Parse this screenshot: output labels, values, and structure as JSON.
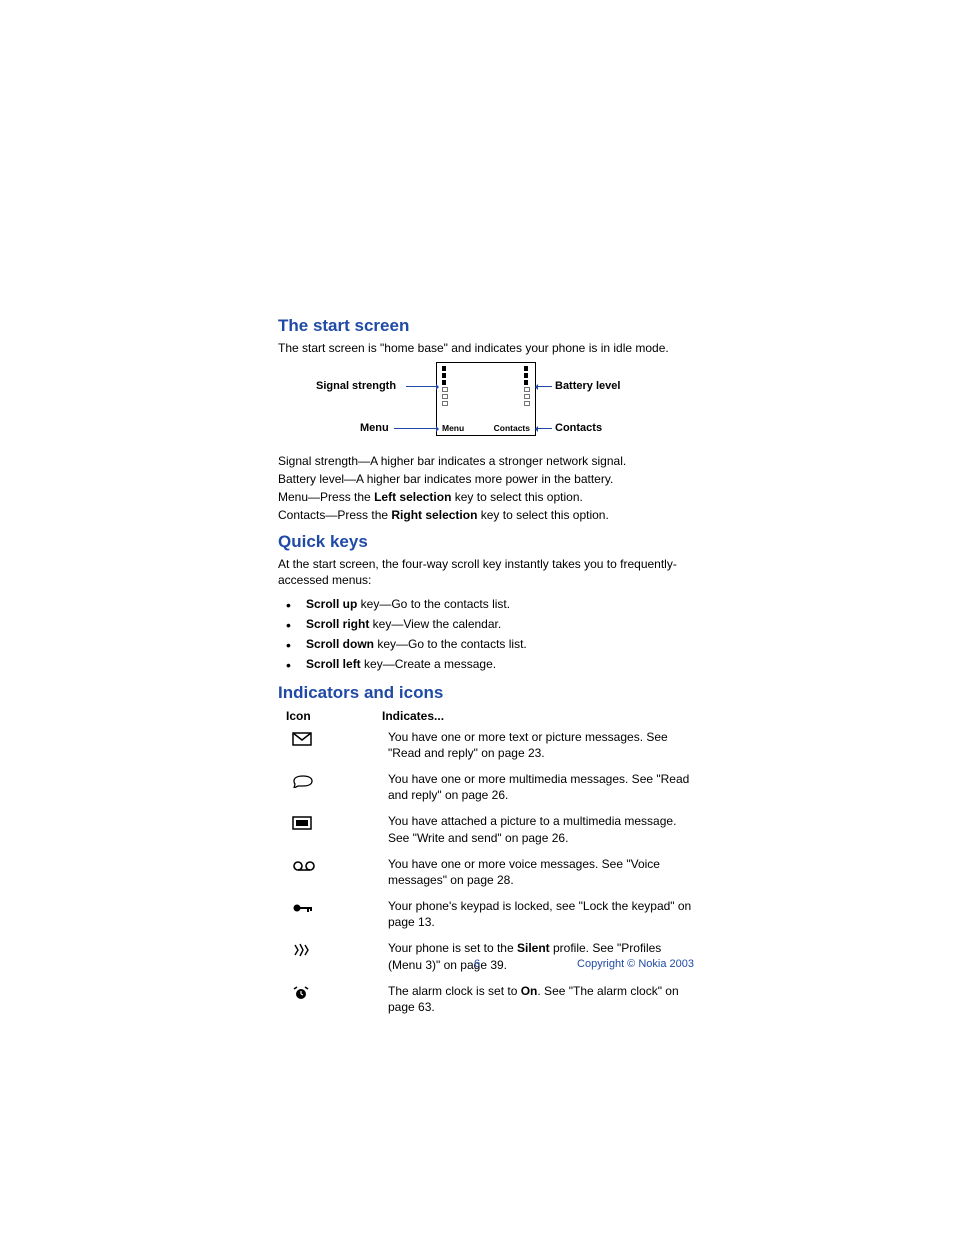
{
  "sections": {
    "start_screen": {
      "heading": "The start screen",
      "intro": "The start screen is \"home base\" and indicates your phone is in idle mode.",
      "callouts": {
        "signal": "Signal strength",
        "battery": "Battery level",
        "menu": "Menu",
        "contacts": "Contacts"
      },
      "screen_labels": {
        "left": "Menu",
        "right": "Contacts"
      },
      "definitions": [
        {
          "term": "Signal strength",
          "sep": "—",
          "text": "A higher bar indicates a stronger network signal."
        },
        {
          "term": "Battery level",
          "sep": "—",
          "text": "A higher bar indicates more power in the battery."
        },
        {
          "term": "Menu",
          "sep": "—",
          "boldpart": "Left selection",
          "pre": "Press the ",
          "post": " key to select this option."
        },
        {
          "term": "Contacts",
          "sep": "—",
          "boldpart": "Right selection",
          "pre": "Press the ",
          "post": " key to select this option."
        }
      ]
    },
    "quick_keys": {
      "heading": "Quick keys",
      "intro": "At the start screen, the four-way scroll key instantly takes you to frequently-accessed menus:",
      "items": [
        {
          "bold": "Scroll up",
          "text": " key—Go to the contacts list."
        },
        {
          "bold": "Scroll right",
          "text": " key—View the calendar."
        },
        {
          "bold": "Scroll down",
          "text": " key—Go to the contacts list."
        },
        {
          "bold": "Scroll left",
          "text": " key—Create a message."
        }
      ]
    },
    "indicators": {
      "heading": "Indicators and icons",
      "header": {
        "icon": "Icon",
        "indicates": "Indicates..."
      },
      "rows": [
        {
          "icon": "envelope",
          "desc": "You have one or more text or picture messages. See \"Read and reply\" on page 23."
        },
        {
          "icon": "mms",
          "desc": "You have one or more multimedia messages. See \"Read and reply\" on page 26."
        },
        {
          "icon": "frame",
          "desc": "You have attached a picture to a multimedia message. See \"Write and send\" on page 26."
        },
        {
          "icon": "voicemail",
          "desc": "You have one or more voice messages. See \"Voice messages\" on page 28."
        },
        {
          "icon": "lock",
          "desc": "Your phone's keypad is locked, see \"Lock the keypad\" on page 13."
        },
        {
          "icon": "silent",
          "bold": "Silent",
          "pre": "Your phone is set to the ",
          "post": " profile. See \"Profiles (Menu 3)\" on page 39."
        },
        {
          "icon": "alarm",
          "bold": "On",
          "pre": "The alarm clock is set to ",
          "post": ". See \"The alarm clock\" on page 63."
        }
      ]
    }
  },
  "footer": {
    "page": "6",
    "copyright": "Copyright © Nokia 2003"
  }
}
